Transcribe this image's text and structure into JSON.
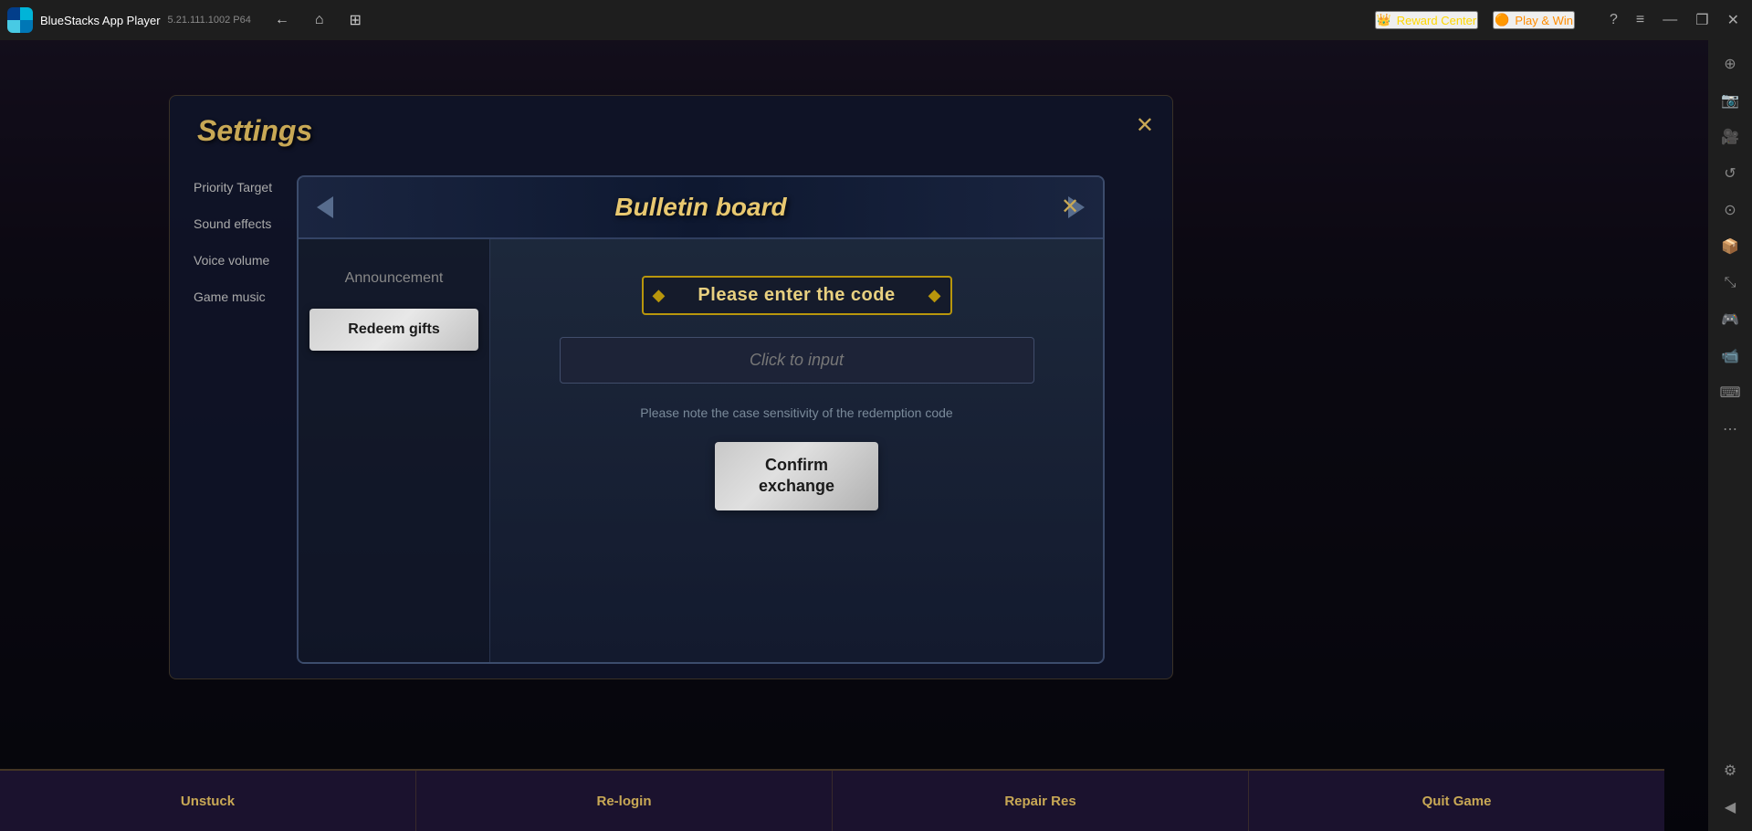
{
  "titlebar": {
    "app_name": "BlueStacks App Player",
    "version": "5.21.111.1002  P64",
    "nav_back": "←",
    "nav_home": "⌂",
    "nav_tab": "▣",
    "reward_center": "Reward Center",
    "play_win": "Play & Win",
    "help": "?",
    "menu": "≡",
    "minimize": "—",
    "maximize": "❐",
    "close": "✕"
  },
  "right_sidebar": {
    "icons": [
      "⊕",
      "⊞",
      "↺",
      "⊙",
      "⊟",
      "🎮",
      "📷",
      "🎬",
      "⌨",
      "📱",
      "⋯",
      "⚙"
    ]
  },
  "settings_bg": {
    "title": "Settings",
    "menu_items": [
      "Priority Target",
      "Sound effects",
      "Voice volume",
      "Game music"
    ]
  },
  "bulletin_modal": {
    "title": "Bulletin board",
    "close_label": "✕",
    "tabs": [
      {
        "label": "Announcement",
        "active": false
      },
      {
        "label": "Redeem gifts",
        "active": true
      }
    ],
    "content": {
      "code_badge_text": "Please enter the code",
      "input_placeholder": "Click to input",
      "note_text": "Please note the case sensitivity of the redemption code",
      "confirm_button": "Confirm\nexchange"
    }
  },
  "bottom_bar": {
    "buttons": [
      "Unstuck",
      "Re-login",
      "Repair Res",
      "Quit Game"
    ]
  }
}
